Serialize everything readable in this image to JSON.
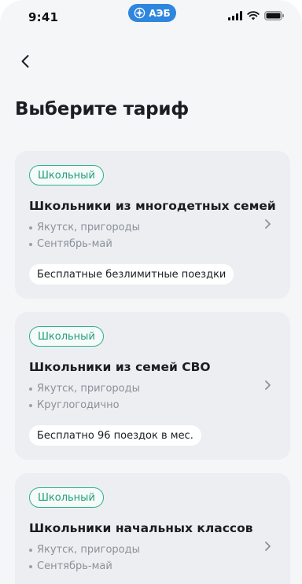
{
  "status_bar": {
    "time": "9:41",
    "brand": "АЭБ",
    "brand_color": "#2e86de"
  },
  "header": {
    "back_icon": "chevron-left-icon",
    "title": "Выберите тариф"
  },
  "tariffs": [
    {
      "badge": "Школьный",
      "title": "Школьники из многодетных семей",
      "region": "Якутск, пригороды",
      "period": "Сентябрь-май",
      "perk": "Бесплатные безлимитные поездки"
    },
    {
      "badge": "Школьный",
      "title": "Школьники из семей СВО",
      "region": "Якутск, пригороды",
      "period": "Круглогодично",
      "perk": "Бесплатно 96 поездок в мес."
    },
    {
      "badge": "Школьный",
      "title": "Школьники начальных классов",
      "region": "Якутск, пригороды",
      "period": "Сентябрь-май",
      "perk": ""
    }
  ],
  "colors": {
    "badge_accent": "#2bb28d",
    "card_bg": "#eceef2",
    "page_bg": "#f5f6f8"
  }
}
